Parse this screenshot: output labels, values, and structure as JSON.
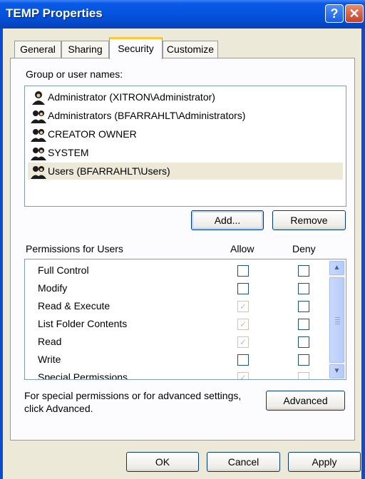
{
  "window": {
    "title": "TEMP Properties",
    "help_glyph": "?",
    "close_glyph": "✕"
  },
  "tabs": [
    {
      "label": "General",
      "active": false
    },
    {
      "label": "Sharing",
      "active": false
    },
    {
      "label": "Security",
      "active": true
    },
    {
      "label": "Customize",
      "active": false
    }
  ],
  "security": {
    "group_label": "Group or user names:",
    "users": [
      {
        "name": "Administrator (XITRON\\Administrator)",
        "icon": "user-icon",
        "selected": false
      },
      {
        "name": "Administrators (BFARRAHLT\\Administrators)",
        "icon": "group-icon",
        "selected": false
      },
      {
        "name": "CREATOR OWNER",
        "icon": "group-icon",
        "selected": false
      },
      {
        "name": "SYSTEM",
        "icon": "group-icon",
        "selected": false
      },
      {
        "name": "Users (BFARRAHLT\\Users)",
        "icon": "group-icon",
        "selected": true
      }
    ],
    "add_button": "Add...",
    "remove_button": "Remove",
    "permissions_label": "Permissions for Users",
    "allow_header": "Allow",
    "deny_header": "Deny",
    "permissions": [
      {
        "name": "Full Control",
        "allow": false,
        "allow_disabled": false,
        "deny": false,
        "deny_disabled": false
      },
      {
        "name": "Modify",
        "allow": false,
        "allow_disabled": false,
        "deny": false,
        "deny_disabled": false
      },
      {
        "name": "Read & Execute",
        "allow": true,
        "allow_disabled": true,
        "deny": false,
        "deny_disabled": false
      },
      {
        "name": "List Folder Contents",
        "allow": true,
        "allow_disabled": true,
        "deny": false,
        "deny_disabled": false
      },
      {
        "name": "Read",
        "allow": true,
        "allow_disabled": true,
        "deny": false,
        "deny_disabled": false
      },
      {
        "name": "Write",
        "allow": false,
        "allow_disabled": false,
        "deny": false,
        "deny_disabled": false
      },
      {
        "name": "Special Permissions",
        "allow": true,
        "allow_disabled": true,
        "deny": false,
        "deny_disabled": true
      }
    ],
    "advanced_text_line1": "For special permissions or for advanced settings,",
    "advanced_text_line2": "click Advanced.",
    "advanced_button": "Advanced"
  },
  "footer": {
    "ok": "OK",
    "cancel": "Cancel",
    "apply": "Apply"
  },
  "colors": {
    "titlebar": "#0553df",
    "face": "#ece9d8",
    "panel": "#fcfcfe",
    "active_tab_accent": "#ffc83c",
    "check": "#21a121"
  }
}
